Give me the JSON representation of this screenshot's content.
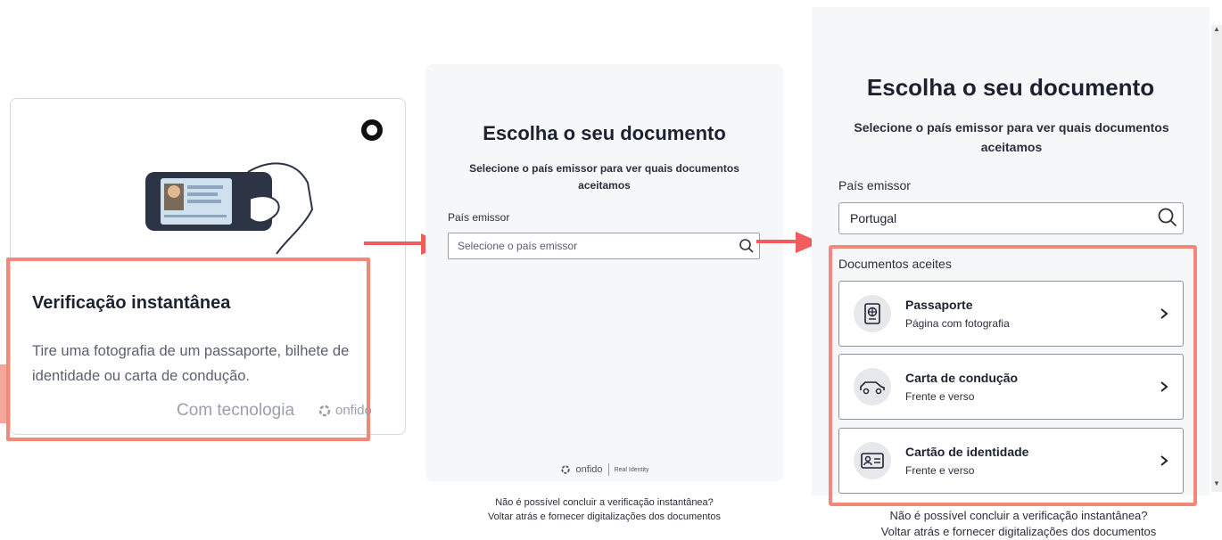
{
  "panel1": {
    "title": "Verificação instantânea",
    "description": "Tire uma fotografia de um passaporte, bilhete de identidade ou carta de condução.",
    "powered_by": "Com tecnologia",
    "brand": "onfido",
    "logo_icon": "onfido-ring-icon"
  },
  "panel2": {
    "title": "Escolha o seu documento",
    "subtitle": "Selecione o país emissor para ver quais documentos aceitamos",
    "country_label": "País emissor",
    "country_placeholder": "Selecione o país emissor",
    "footer_brand": "onfido",
    "footer_tagline": "Real Identity",
    "note_line1": "Não é possível concluir a verificação instantânea?",
    "note_line2": "Voltar atrás e fornecer digitalizações dos documentos"
  },
  "panel3": {
    "title": "Escolha o seu documento",
    "subtitle": "Selecione o país emissor para ver quais documentos aceitamos",
    "country_label": "País emissor",
    "country_value": "Portugal",
    "docs_label": "Documentos aceites",
    "documents": [
      {
        "title": "Passaporte",
        "subtitle": "Página com fotografia",
        "icon": "passport-icon"
      },
      {
        "title": "Carta de condução",
        "subtitle": "Frente e verso",
        "icon": "car-icon"
      },
      {
        "title": "Cartão de identidade",
        "subtitle": "Frente e verso",
        "icon": "id-card-icon"
      }
    ],
    "note_line1": "Não é possível concluir a verificação instantânea?",
    "note_line2": "Voltar atrás e fornecer digitalizações dos documentos"
  },
  "colors": {
    "highlight": "#f3887a",
    "arrow": "#f25c5c",
    "panel_bg": "#f6f7f9"
  }
}
